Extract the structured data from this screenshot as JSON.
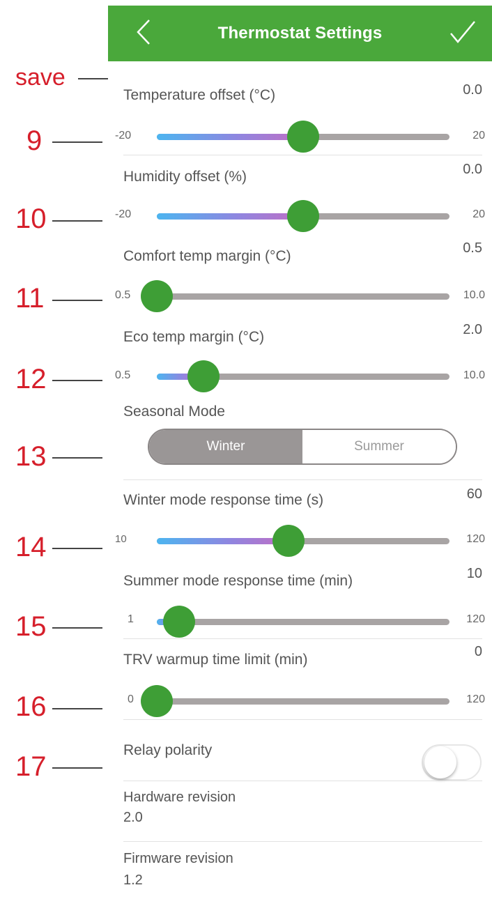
{
  "header": {
    "title": "Thermostat Settings",
    "back_icon": "chevron-left-icon",
    "save_icon": "checkmark-icon",
    "color": "#4aa83b"
  },
  "annotations": {
    "save": "save",
    "n9": "9",
    "n10": "10",
    "n11": "11",
    "n12": "12",
    "n13": "13",
    "n14": "14",
    "n15": "15",
    "n16": "16",
    "n17": "17"
  },
  "settings": {
    "temperature_offset": {
      "label": "Temperature offset (°C)",
      "value": "0.0",
      "min": "-20",
      "max": "20",
      "level": 0.5
    },
    "humidity_offset": {
      "label": "Humidity offset (%)",
      "value": "0.0",
      "min": "-20",
      "max": "20",
      "level": 0.5
    },
    "comfort_margin": {
      "label": "Comfort temp margin (°C)",
      "value": "0.5",
      "min": "0.5",
      "max": "10.0",
      "level": 0.0
    },
    "eco_margin": {
      "label": "Eco temp margin (°C)",
      "value": "2.0",
      "min": "0.5",
      "max": "10.0",
      "level": 0.16
    },
    "seasonal_mode": {
      "label": "Seasonal Mode",
      "options": [
        "Winter",
        "Summer"
      ],
      "selected": "Winter"
    },
    "winter_response": {
      "label": "Winter mode response time (s)",
      "value": "60",
      "min": "10",
      "max": "120",
      "level": 0.45
    },
    "summer_response": {
      "label": "Summer mode response time (min)",
      "value": "10",
      "min": "1",
      "max": "120",
      "level": 0.076
    },
    "trv_warmup": {
      "label": "TRV warmup time limit (min)",
      "value": "0",
      "min": "0",
      "max": "120",
      "level": 0.0
    },
    "relay_polarity": {
      "label": "Relay polarity",
      "on": false
    },
    "hardware_revision": {
      "label": "Hardware revision",
      "value": "2.0"
    },
    "firmware_revision": {
      "label": "Firmware revision",
      "value": "1.2"
    }
  }
}
